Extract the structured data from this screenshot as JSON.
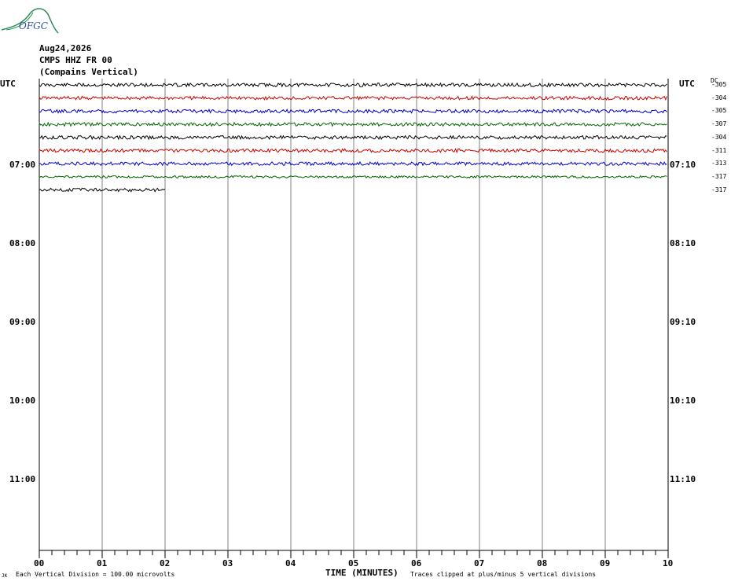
{
  "logo_text": "OFGC",
  "header": {
    "date": "Aug24,2026",
    "station": "CMPS HHZ FR 00",
    "location": "(Compains Vertical)"
  },
  "utc_label_left": "UTC",
  "utc_label_right": "UTC",
  "dc_label": "DC",
  "footer": {
    "corner_mark": "JK",
    "division": "Each Vertical Division =  100.00 microvolts",
    "clip_note": "Traces clipped at plus/minus 5 vertical divisions"
  },
  "colors": {
    "black": "#000000",
    "red": "#cc0000",
    "blue": "#0000cc",
    "green": "#006600",
    "grid": "#808080",
    "logo": "#2e8b57"
  },
  "chart_data": {
    "type": "line",
    "title": "CMPS HHZ FR 00 (Compains Vertical)",
    "xlabel": "TIME (MINUTES)",
    "ylabel": "UTC",
    "xlim": [
      0,
      10
    ],
    "x_ticks": [
      "00",
      "01",
      "02",
      "03",
      "04",
      "05",
      "06",
      "07",
      "08",
      "09",
      "10"
    ],
    "hour_labels_left": [
      "07:00",
      "08:00",
      "09:00",
      "10:00",
      "11:00"
    ],
    "hour_labels_right": [
      "07:10",
      "08:10",
      "09:10",
      "10:10",
      "11:10"
    ],
    "traces": [
      {
        "index": 0,
        "color": "#000000",
        "dc": "-305",
        "start_min": 0,
        "end_min": 10
      },
      {
        "index": 1,
        "color": "#cc0000",
        "dc": "-304",
        "start_min": 0,
        "end_min": 10
      },
      {
        "index": 2,
        "color": "#0000cc",
        "dc": "-305",
        "start_min": 0,
        "end_min": 10
      },
      {
        "index": 3,
        "color": "#006600",
        "dc": "-307",
        "start_min": 0,
        "end_min": 10
      },
      {
        "index": 4,
        "color": "#000000",
        "dc": "-304",
        "start_min": 0,
        "end_min": 10
      },
      {
        "index": 5,
        "color": "#cc0000",
        "dc": "-311",
        "start_min": 0,
        "end_min": 10
      },
      {
        "index": 6,
        "color": "#0000cc",
        "dc": "-313",
        "start_min": 0,
        "end_min": 10
      },
      {
        "index": 7,
        "color": "#006600",
        "dc": "-317",
        "start_min": 0,
        "end_min": 10
      },
      {
        "index": 8,
        "color": "#000000",
        "dc": "-317",
        "start_min": 0,
        "end_min": 2
      }
    ]
  }
}
